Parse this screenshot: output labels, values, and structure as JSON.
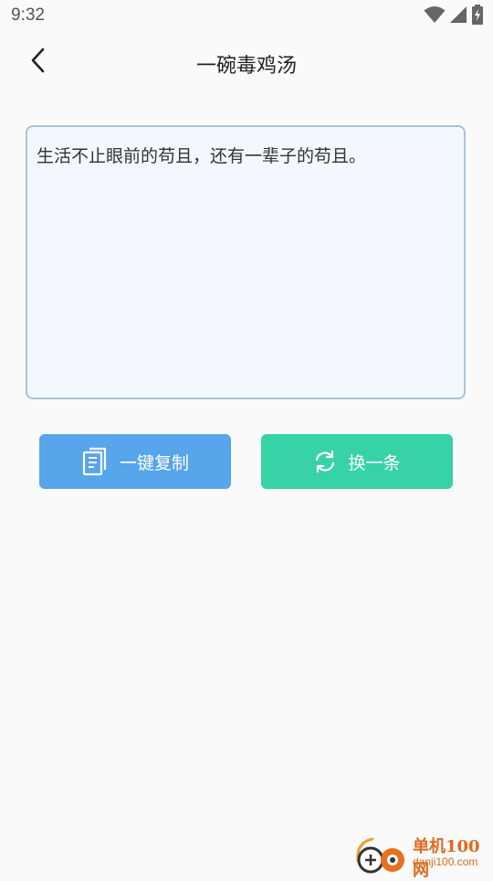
{
  "status_bar": {
    "time": "9:32",
    "icons": [
      "wifi-icon",
      "cell-signal-icon",
      "battery-charging-icon"
    ]
  },
  "app_bar": {
    "title": "一碗毒鸡汤",
    "back_icon": "chevron-left-icon"
  },
  "quote": {
    "text": "生活不止眼前的苟且，还有一辈子的苟且。"
  },
  "actions": {
    "copy_label": "一键复制",
    "copy_icon": "copy-document-icon",
    "copy_color": "#57a5eb",
    "next_label": "换一条",
    "next_icon": "refresh-icon",
    "next_color": "#37d3a6"
  },
  "watermark": {
    "name": "单机100网",
    "domain": "danji100.com"
  }
}
